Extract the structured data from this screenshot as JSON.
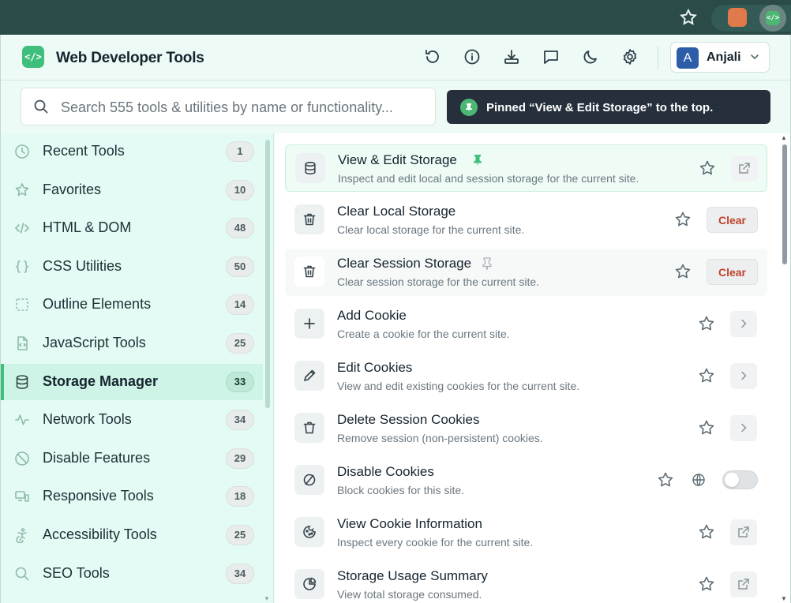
{
  "app": {
    "title": "Web Developer Tools",
    "logo_text": "</>",
    "brand_color": "#3fbf7c"
  },
  "header": {
    "icons": [
      "refresh-icon",
      "info-icon",
      "download-icon",
      "message-icon",
      "moon-icon",
      "gear-icon"
    ],
    "profile": {
      "initial": "A",
      "name": "Anjali"
    }
  },
  "search": {
    "placeholder": "Search 555 tools & utilities by name or functionality..."
  },
  "toast": {
    "text": "Pinned “View & Edit Storage” to the top."
  },
  "sidebar": {
    "items": [
      {
        "label": "Recent Tools",
        "count": "1",
        "icon": "clock-icon"
      },
      {
        "label": "Favorites",
        "count": "10",
        "icon": "star-icon"
      },
      {
        "label": "HTML & DOM",
        "count": "48",
        "icon": "code-icon"
      },
      {
        "label": "CSS Utilities",
        "count": "50",
        "icon": "braces-icon"
      },
      {
        "label": "Outline Elements",
        "count": "14",
        "icon": "dashed-square-icon"
      },
      {
        "label": "JavaScript Tools",
        "count": "25",
        "icon": "js-file-icon"
      },
      {
        "label": "Storage Manager",
        "count": "33",
        "icon": "database-icon",
        "active": true
      },
      {
        "label": "Network Tools",
        "count": "34",
        "icon": "activity-icon"
      },
      {
        "label": "Disable Features",
        "count": "29",
        "icon": "ban-icon"
      },
      {
        "label": "Responsive Tools",
        "count": "18",
        "icon": "devices-icon"
      },
      {
        "label": "Accessibility Tools",
        "count": "25",
        "icon": "accessibility-icon"
      },
      {
        "label": "SEO Tools",
        "count": "34",
        "icon": "search-icon"
      }
    ]
  },
  "tools": [
    {
      "title": "View & Edit Storage",
      "desc": "Inspect and edit local and session storage for the current site.",
      "icon": "database-icon",
      "pinned": true,
      "action": "open"
    },
    {
      "title": "Clear Local Storage",
      "desc": "Clear local storage for the current site.",
      "icon": "trash-icon",
      "action": "clear",
      "action_label": "Clear"
    },
    {
      "title": "Clear Session Storage",
      "desc": "Clear session storage for the current site.",
      "icon": "trash-icon",
      "pin_hover": true,
      "action": "clear",
      "action_label": "Clear"
    },
    {
      "title": "Add Cookie",
      "desc": "Create a cookie for the current site.",
      "icon": "plus-icon",
      "action": "chevron"
    },
    {
      "title": "Edit Cookies",
      "desc": "View and edit existing cookies for the current site.",
      "icon": "pencil-icon",
      "action": "chevron"
    },
    {
      "title": "Delete Session Cookies",
      "desc": "Remove session (non-persistent) cookies.",
      "icon": "trash-icon",
      "action": "chevron"
    },
    {
      "title": "Disable Cookies",
      "desc": "Block cookies for this site.",
      "icon": "ban-icon",
      "action": "toggle",
      "toggle_on": false
    },
    {
      "title": "View Cookie Information",
      "desc": "Inspect every cookie for the current site.",
      "icon": "cookie-icon",
      "action": "open"
    },
    {
      "title": "Storage Usage Summary",
      "desc": "View total storage consumed.",
      "icon": "pie-chart-icon",
      "action": "open"
    }
  ]
}
